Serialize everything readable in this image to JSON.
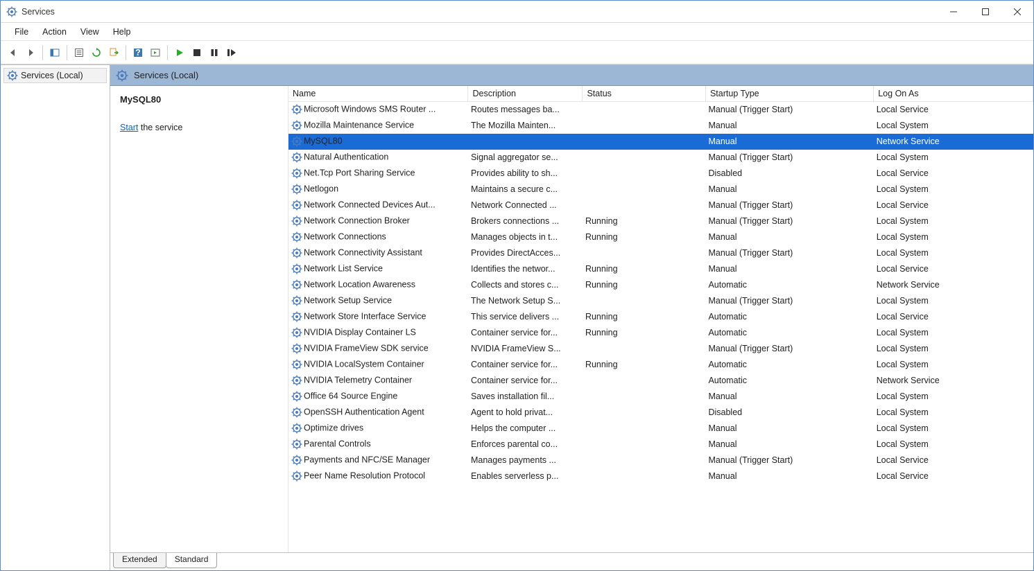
{
  "window": {
    "title": "Services"
  },
  "menu": {
    "items": [
      "File",
      "Action",
      "View",
      "Help"
    ]
  },
  "tree": {
    "root_label": "Services (Local)"
  },
  "header": {
    "title": "Services (Local)"
  },
  "detail": {
    "selected_name": "MySQL80",
    "action_link": "Start",
    "action_suffix": " the service"
  },
  "columns": [
    "Name",
    "Description",
    "Status",
    "Startup Type",
    "Log On As"
  ],
  "services": [
    {
      "name": "Microsoft Windows SMS Router ...",
      "desc": "Routes messages ba...",
      "status": "",
      "startup": "Manual (Trigger Start)",
      "logon": "Local Service",
      "sel": false
    },
    {
      "name": "Mozilla Maintenance Service",
      "desc": "The Mozilla Mainten...",
      "status": "",
      "startup": "Manual",
      "logon": "Local System",
      "sel": false
    },
    {
      "name": "MySQL80",
      "desc": "",
      "status": "",
      "startup": "Manual",
      "logon": "Network Service",
      "sel": true
    },
    {
      "name": "Natural Authentication",
      "desc": "Signal aggregator se...",
      "status": "",
      "startup": "Manual (Trigger Start)",
      "logon": "Local System",
      "sel": false
    },
    {
      "name": "Net.Tcp Port Sharing Service",
      "desc": "Provides ability to sh...",
      "status": "",
      "startup": "Disabled",
      "logon": "Local Service",
      "sel": false
    },
    {
      "name": "Netlogon",
      "desc": "Maintains a secure c...",
      "status": "",
      "startup": "Manual",
      "logon": "Local System",
      "sel": false
    },
    {
      "name": "Network Connected Devices Aut...",
      "desc": "Network Connected ...",
      "status": "",
      "startup": "Manual (Trigger Start)",
      "logon": "Local Service",
      "sel": false
    },
    {
      "name": "Network Connection Broker",
      "desc": "Brokers connections ...",
      "status": "Running",
      "startup": "Manual (Trigger Start)",
      "logon": "Local System",
      "sel": false
    },
    {
      "name": "Network Connections",
      "desc": "Manages objects in t...",
      "status": "Running",
      "startup": "Manual",
      "logon": "Local System",
      "sel": false
    },
    {
      "name": "Network Connectivity Assistant",
      "desc": "Provides DirectAcces...",
      "status": "",
      "startup": "Manual (Trigger Start)",
      "logon": "Local System",
      "sel": false
    },
    {
      "name": "Network List Service",
      "desc": "Identifies the networ...",
      "status": "Running",
      "startup": "Manual",
      "logon": "Local Service",
      "sel": false
    },
    {
      "name": "Network Location Awareness",
      "desc": "Collects and stores c...",
      "status": "Running",
      "startup": "Automatic",
      "logon": "Network Service",
      "sel": false
    },
    {
      "name": "Network Setup Service",
      "desc": "The Network Setup S...",
      "status": "",
      "startup": "Manual (Trigger Start)",
      "logon": "Local System",
      "sel": false
    },
    {
      "name": "Network Store Interface Service",
      "desc": "This service delivers ...",
      "status": "Running",
      "startup": "Automatic",
      "logon": "Local Service",
      "sel": false
    },
    {
      "name": "NVIDIA Display Container LS",
      "desc": "Container service for...",
      "status": "Running",
      "startup": "Automatic",
      "logon": "Local System",
      "sel": false
    },
    {
      "name": "NVIDIA FrameView SDK service",
      "desc": "NVIDIA FrameView S...",
      "status": "",
      "startup": "Manual (Trigger Start)",
      "logon": "Local System",
      "sel": false
    },
    {
      "name": "NVIDIA LocalSystem Container",
      "desc": "Container service for...",
      "status": "Running",
      "startup": "Automatic",
      "logon": "Local System",
      "sel": false
    },
    {
      "name": "NVIDIA Telemetry Container",
      "desc": "Container service for...",
      "status": "",
      "startup": "Automatic",
      "logon": "Network Service",
      "sel": false
    },
    {
      "name": "Office 64 Source Engine",
      "desc": "Saves installation fil...",
      "status": "",
      "startup": "Manual",
      "logon": "Local System",
      "sel": false
    },
    {
      "name": "OpenSSH Authentication Agent",
      "desc": "Agent to hold privat...",
      "status": "",
      "startup": "Disabled",
      "logon": "Local System",
      "sel": false
    },
    {
      "name": "Optimize drives",
      "desc": "Helps the computer ...",
      "status": "",
      "startup": "Manual",
      "logon": "Local System",
      "sel": false
    },
    {
      "name": "Parental Controls",
      "desc": "Enforces parental co...",
      "status": "",
      "startup": "Manual",
      "logon": "Local System",
      "sel": false
    },
    {
      "name": "Payments and NFC/SE Manager",
      "desc": "Manages payments ...",
      "status": "",
      "startup": "Manual (Trigger Start)",
      "logon": "Local Service",
      "sel": false
    },
    {
      "name": "Peer Name Resolution Protocol",
      "desc": "Enables serverless p...",
      "status": "",
      "startup": "Manual",
      "logon": "Local Service",
      "sel": false
    }
  ],
  "tabs": {
    "extended": "Extended",
    "standard": "Standard"
  }
}
